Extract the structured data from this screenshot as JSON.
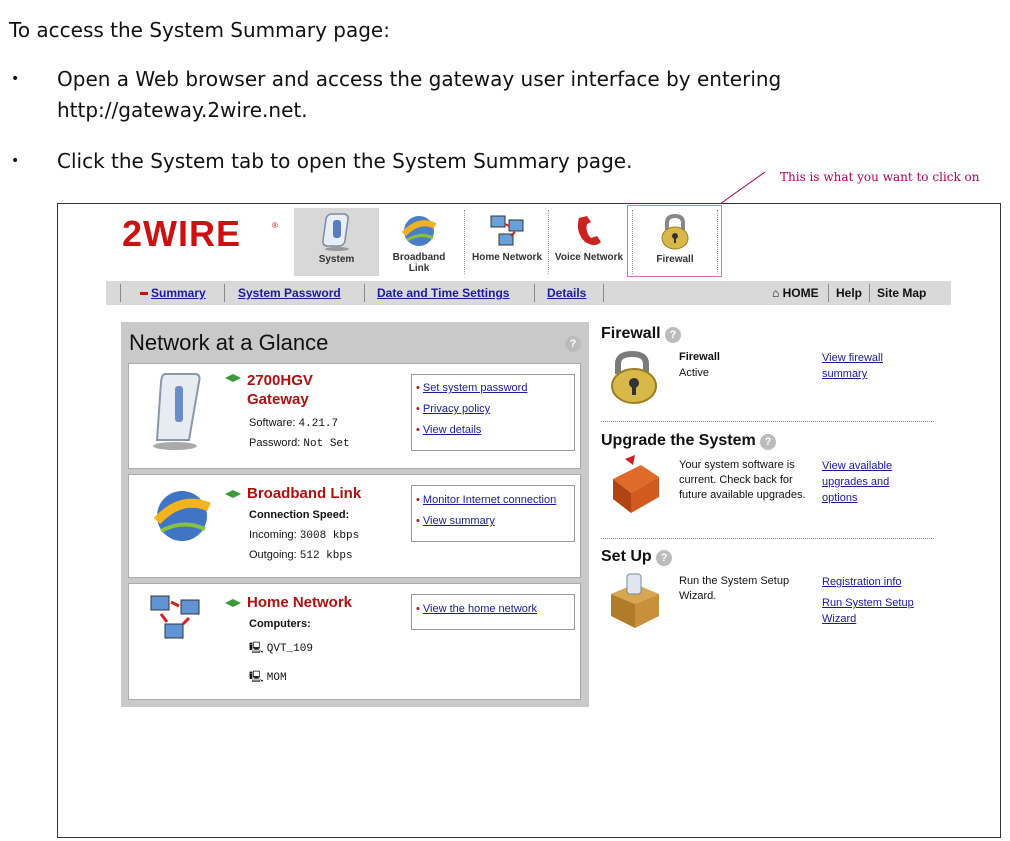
{
  "doc": {
    "intro": "To access the System Summary page:",
    "bullets": [
      {
        "line1": "Open a Web browser and access the gateway user interface by entering",
        "line2": "http://gateway.2wire.net."
      },
      {
        "line1": "Click the System tab to open the System Summary page."
      }
    ],
    "annotation": "This is what you want to click on"
  },
  "logo": {
    "text": "2WIRE"
  },
  "tabs": [
    {
      "label": "System",
      "icon": "system-icon",
      "active": true
    },
    {
      "label": "Broadband Link",
      "icon": "globe-icon"
    },
    {
      "label": "Home Network",
      "icon": "network-icon"
    },
    {
      "label": "Voice Network",
      "icon": "phone-icon"
    },
    {
      "label": "Firewall",
      "icon": "lock-icon"
    }
  ],
  "subnav": {
    "items": [
      "Summary",
      "System Password",
      "Date and Time Settings",
      "Details"
    ],
    "home": "HOME",
    "help": "Help",
    "sitemap": "Site Map"
  },
  "glance": {
    "title": "Network at a Glance",
    "gateway": {
      "name": "2700HGV Gateway",
      "software_label": "Software:",
      "software_value": "4.21.7",
      "password_label": "Password:",
      "password_value": "Not Set",
      "links": [
        "Set system password",
        "Privacy policy",
        "View details"
      ]
    },
    "broadband": {
      "name": "Broadband Link",
      "speed_label": "Connection Speed:",
      "incoming_label": "Incoming:",
      "incoming_value": "3008 kbps",
      "outgoing_label": "Outgoing:",
      "outgoing_value": "512 kbps",
      "links": [
        "Monitor Internet connection",
        "View summary"
      ]
    },
    "home": {
      "name": "Home Network",
      "computers_label": "Computers:",
      "computers": [
        "QVT_109",
        "MOM"
      ],
      "links": [
        "View the home network"
      ]
    }
  },
  "right": {
    "firewall": {
      "title": "Firewall",
      "status_label": "Firewall",
      "status_value": "Active",
      "link": "View firewall summary"
    },
    "upgrade": {
      "title": "Upgrade the System",
      "text": "Your system software is current. Check back for future available upgrades.",
      "link": "View available upgrades and options"
    },
    "setup": {
      "title": "Set Up",
      "text": "Run the System Setup Wizard.",
      "links": [
        "Registration info",
        "Run System Setup Wizard"
      ]
    }
  },
  "colors": {
    "brand_red": "#cc1111",
    "link": "#1a1a9a",
    "accent_green": "#3a9a3a",
    "highlight": "#d070b0"
  }
}
